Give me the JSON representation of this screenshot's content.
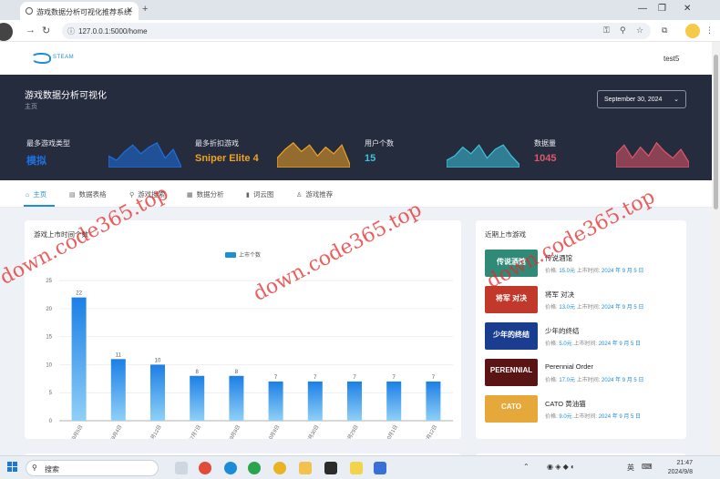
{
  "browser": {
    "tab_title": "游戏数据分析可视化推荐系统",
    "new_tab": "+",
    "url": "127.0.0.1:5000/home"
  },
  "header": {
    "logo_text": "STEAM",
    "user": "test5"
  },
  "hero": {
    "title": "游戏数据分析可视化",
    "subtitle": "主页",
    "date": "September 30, 2024",
    "stats": [
      {
        "label": "最多游戏类型",
        "value": "模拟",
        "color": "#1e6fe0"
      },
      {
        "label": "最多折扣游戏",
        "value": "Sniper Elite 4",
        "color": "#f0a224"
      },
      {
        "label": "用户个数",
        "value": "15",
        "color": "#3dc2dc"
      },
      {
        "label": "数据量",
        "value": "1045",
        "color": "#e0566a"
      }
    ]
  },
  "tabs": [
    {
      "label": "主页",
      "icon": "home-icon"
    },
    {
      "label": "数据表格",
      "icon": "table-icon"
    },
    {
      "label": "游戏搜索",
      "icon": "search-icon"
    },
    {
      "label": "数据分析",
      "icon": "grid-icon"
    },
    {
      "label": "词云图",
      "icon": "bar-chart-icon"
    },
    {
      "label": "游戏推荐",
      "icon": "thumb-icon"
    }
  ],
  "chart_data": {
    "type": "bar",
    "title": "游戏上市时间个数",
    "legend": "上市个数",
    "categories": [
      "2024年9月5日",
      "2024年9月4日",
      "2022年5月12日",
      "2022年7月7日",
      "2022年9月8日",
      "2019年10月9日",
      "2024年8月30日",
      "2024年8月29日",
      "2017年10月1日",
      "2024年9月12日"
    ],
    "values": [
      22,
      11,
      10,
      8,
      8,
      7,
      7,
      7,
      7,
      7
    ],
    "yticks": [
      0,
      5,
      10,
      15,
      20,
      25
    ],
    "ylim": [
      0,
      26
    ],
    "grid": true
  },
  "recent": {
    "title": "近期上市游戏",
    "price_label": "价格:",
    "date_label": "上市时间:",
    "items": [
      {
        "name": "传说酒馆",
        "price": "15.0元",
        "date": "2024 年 9 月 5 日",
        "thumb": "传说酒馆",
        "bg": "#2f8a78"
      },
      {
        "name": "将军 对决",
        "price": "13.0元",
        "date": "2024 年 9 月 5 日",
        "thumb": "将军 对决",
        "bg": "#c0392b"
      },
      {
        "name": "少年的终结",
        "price": "5.0元",
        "date": "2024 年 9 月 5 日",
        "thumb": "少年的终结",
        "bg": "#1b3d8f"
      },
      {
        "name": "Perennial Order",
        "price": "17.0元",
        "date": "2024 年 9 月 5 日",
        "thumb": "PERENNIAL",
        "bg": "#5a1414"
      },
      {
        "name": "CATO 黄油猫",
        "price": "9.0元",
        "date": "2024 年 9 月 5 日",
        "thumb": "CATO",
        "bg": "#e6a83a"
      }
    ]
  },
  "watermark": "down.code365.top",
  "taskbar": {
    "search": "搜索",
    "lang": "英",
    "time": "21:47",
    "date": "2024/9/8"
  }
}
